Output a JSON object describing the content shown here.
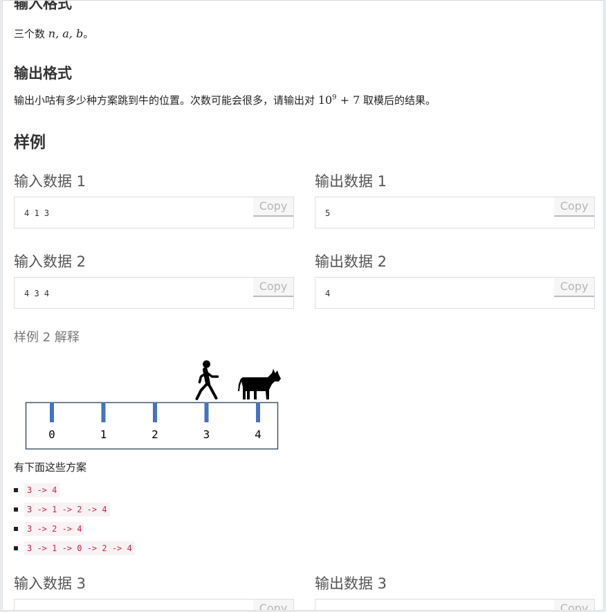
{
  "input_format": {
    "heading": "输入格式",
    "text_prefix": "三个数 ",
    "math": "n, a, b",
    "text_suffix": "。"
  },
  "output_format": {
    "heading": "输出格式",
    "text_prefix": "输出小咕有多少种方案跳到牛的位置。次数可能会很多，请输出对 ",
    "math_base": "10",
    "math_exp": "9",
    "math_tail": " + 7",
    "text_suffix": " 取模后的结果。"
  },
  "samples_heading": "样例",
  "copy_label": "Copy",
  "samples": [
    {
      "input_title": "输入数据 1",
      "input": "4 1 3",
      "output_title": "输出数据 1",
      "output": "5"
    },
    {
      "input_title": "输入数据 2",
      "input": "4 3 4",
      "output_title": "输出数据 2",
      "output": "4"
    },
    {
      "input_title": "输入数据 3",
      "input": "",
      "output_title": "输出数据 3",
      "output": ""
    }
  ],
  "explanation": {
    "title": "样例 2 解释",
    "figure": {
      "positions": [
        "0",
        "1",
        "2",
        "3",
        "4"
      ],
      "person_at": 3,
      "cow_at": 4,
      "tick_color": "#4472c4",
      "icons": [
        "running-person-icon",
        "cow-icon"
      ]
    },
    "list_intro": "有下面这些方案",
    "solutions": [
      "3 -> 4",
      "3 -> 1 -> 2 -> 4",
      "3 -> 2 -> 4",
      "3 -> 1 -> 0 -> 2 -> 4"
    ]
  }
}
